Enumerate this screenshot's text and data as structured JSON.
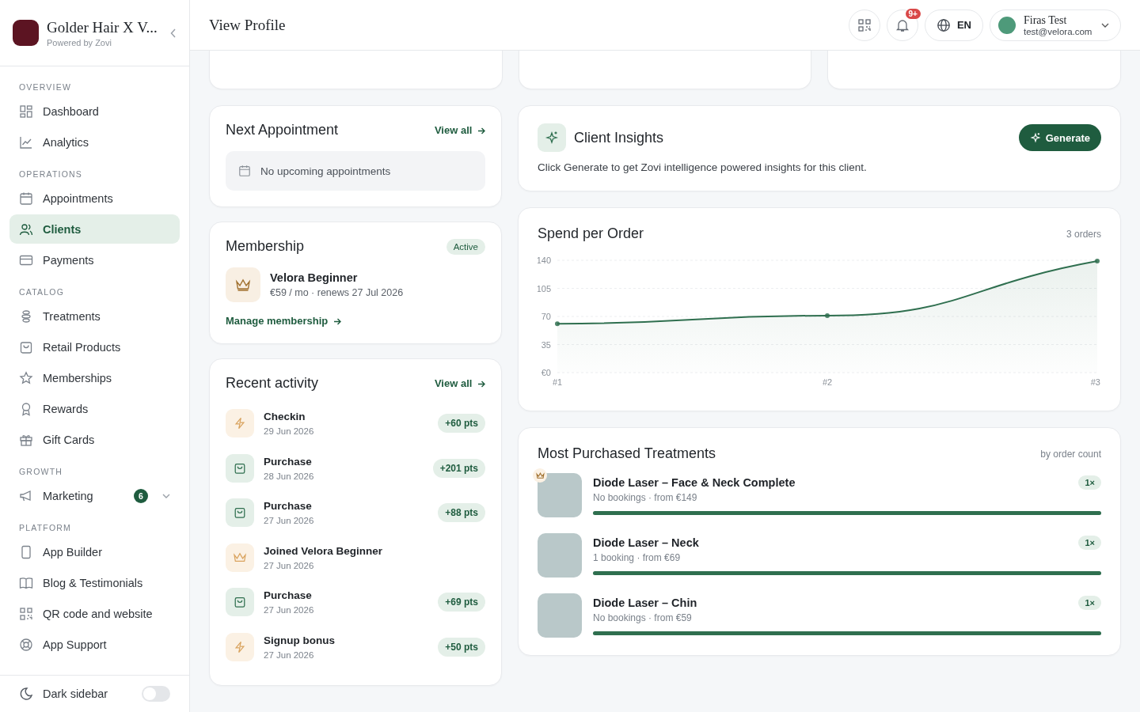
{
  "brand": {
    "name": "Golder Hair X V...",
    "subtitle": "Powered by Zovi"
  },
  "sidebar": {
    "sections": [
      {
        "title": "OVERVIEW",
        "items": [
          {
            "label": "Dashboard",
            "selected": false
          },
          {
            "label": "Analytics",
            "selected": false
          }
        ]
      },
      {
        "title": "OPERATIONS",
        "items": [
          {
            "label": "Appointments",
            "selected": false
          },
          {
            "label": "Clients",
            "selected": true
          },
          {
            "label": "Payments",
            "selected": false
          }
        ]
      },
      {
        "title": "CATALOG",
        "items": [
          {
            "label": "Treatments",
            "selected": false
          },
          {
            "label": "Retail Products",
            "selected": false
          },
          {
            "label": "Memberships",
            "selected": false
          },
          {
            "label": "Rewards",
            "selected": false
          },
          {
            "label": "Gift Cards",
            "selected": false
          }
        ]
      },
      {
        "title": "GROWTH",
        "items": [
          {
            "label": "Marketing",
            "selected": false,
            "badge": "6",
            "expanded": false
          }
        ]
      },
      {
        "title": "PLATFORM",
        "items": [
          {
            "label": "App Builder",
            "selected": false
          },
          {
            "label": "Blog & Testimonials",
            "selected": false
          },
          {
            "label": "QR code and website",
            "selected": false
          },
          {
            "label": "App Support",
            "selected": false
          }
        ]
      }
    ],
    "dark_toggle": {
      "label": "Dark sidebar",
      "on": false
    }
  },
  "header": {
    "title": "View Profile",
    "notification_count": "9+",
    "language": "EN",
    "user": {
      "name": "Firas Test",
      "email": "test@velora.com"
    }
  },
  "next_appointment": {
    "title": "Next Appointment",
    "link": "View all",
    "empty": "No upcoming appointments"
  },
  "membership": {
    "title": "Membership",
    "status": "Active",
    "plan": "Velora Beginner",
    "details": "€59 / mo · renews 27 Jul 2026",
    "link": "Manage membership"
  },
  "recent_activity": {
    "title": "Recent activity",
    "link": "View all",
    "items": [
      {
        "kind": "checkin",
        "title": "Checkin",
        "date": "29 Jun 2026",
        "points": "+60 pts"
      },
      {
        "kind": "purchase",
        "title": "Purchase",
        "date": "28 Jun 2026",
        "points": "+201 pts"
      },
      {
        "kind": "purchase",
        "title": "Purchase",
        "date": "27 Jun 2026",
        "points": "+88 pts"
      },
      {
        "kind": "membership",
        "title": "Joined Velora Beginner",
        "date": "27 Jun 2026"
      },
      {
        "kind": "purchase",
        "title": "Purchase",
        "date": "27 Jun 2026",
        "points": "+69 pts"
      },
      {
        "kind": "bonus",
        "title": "Signup bonus",
        "date": "27 Jun 2026",
        "points": "+50 pts"
      }
    ]
  },
  "client_insights": {
    "title": "Client Insights",
    "button": "Generate",
    "text": "Click Generate to get Zovi intelligence powered insights for this client."
  },
  "spend_per_order": {
    "title": "Spend per Order",
    "meta": "3 orders",
    "chart_data": {
      "type": "area",
      "categories": [
        "#1",
        "#2",
        "#3"
      ],
      "series": [
        {
          "color": "#2f6f4f",
          "values": [
            61,
            71,
            139
          ]
        }
      ],
      "ylim": [
        0,
        140
      ],
      "grid": true,
      "yticks": [
        {
          "value": 0,
          "label": "€0"
        },
        {
          "value": 35,
          "label": "35"
        },
        {
          "value": 70,
          "label": "70"
        },
        {
          "value": 105,
          "label": "105"
        },
        {
          "value": 140,
          "label": "140"
        }
      ]
    }
  },
  "most_purchased": {
    "title": "Most Purchased Treatments",
    "meta": "by order count",
    "items": [
      {
        "name": "Diode Laser – Face & Neck Complete",
        "details": "No bookings · from €149",
        "count": "1×",
        "level": 1,
        "top": true
      },
      {
        "name": "Diode Laser – Neck",
        "details": "1 booking · from €69",
        "count": "1×",
        "level": 1,
        "top": false
      },
      {
        "name": "Diode Laser – Chin",
        "details": "No bookings · from €59",
        "count": "1×",
        "level": 1,
        "top": false
      }
    ]
  }
}
